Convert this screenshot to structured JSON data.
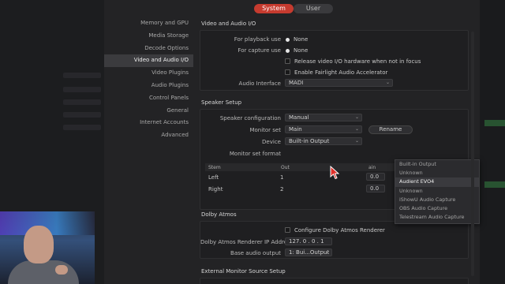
{
  "tabs": {
    "system": "System",
    "user": "User"
  },
  "sidebar": {
    "items": [
      {
        "label": "Memory and GPU"
      },
      {
        "label": "Media Storage"
      },
      {
        "label": "Decode Options"
      },
      {
        "label": "Video and Audio I/O"
      },
      {
        "label": "Video Plugins"
      },
      {
        "label": "Audio Plugins"
      },
      {
        "label": "Control Panels"
      },
      {
        "label": "General"
      },
      {
        "label": "Internet Accounts"
      },
      {
        "label": "Advanced"
      }
    ]
  },
  "video_audio": {
    "title": "Video and Audio I/O",
    "playback_label": "For playback use",
    "playback_value": "None",
    "capture_label": "For capture use",
    "capture_value": "None",
    "release_label": "Release video I/O hardware when not in focus",
    "fairlight_label": "Enable Fairlight Audio Accelerator",
    "audio_interface_label": "Audio Interface",
    "audio_interface_value": "MADI"
  },
  "speaker": {
    "title": "Speaker Setup",
    "config_label": "Speaker configuration",
    "config_value": "Manual",
    "monitor_set_label": "Monitor set",
    "monitor_set_value": "Main",
    "rename_label": "Rename",
    "device_label": "Device",
    "device_value": "Built-in Output",
    "format_label": "Monitor set format",
    "table": {
      "col_stem": "Stem",
      "col_out": "Out",
      "col_gain": "ain",
      "rows": [
        {
          "stem": "Left",
          "out": "1",
          "gain": "0.0"
        },
        {
          "stem": "Right",
          "out": "2",
          "gain": "0.0"
        }
      ]
    }
  },
  "device_menu": {
    "items": [
      {
        "label": "Built-in Output"
      },
      {
        "label": "Unknown"
      },
      {
        "label": "Audient EVO4"
      },
      {
        "label": "Unknown"
      },
      {
        "label": "iShowU Audio Capture"
      },
      {
        "label": "OBS Audio Capture"
      },
      {
        "label": "Telestream Audio Capture"
      }
    ]
  },
  "dolby": {
    "title": "Dolby Atmos",
    "configure_label": "Configure Dolby Atmos Renderer",
    "ip_label": "Dolby Atmos Renderer IP Address",
    "ip_value": "127. 0 . 0 . 1",
    "base_label": "Base audio output",
    "base_value": "1: Bui...Output"
  },
  "external": {
    "title": "External Monitor Source Setup"
  },
  "colors": {
    "accent": "#c63b2f",
    "panel": "#232325"
  }
}
